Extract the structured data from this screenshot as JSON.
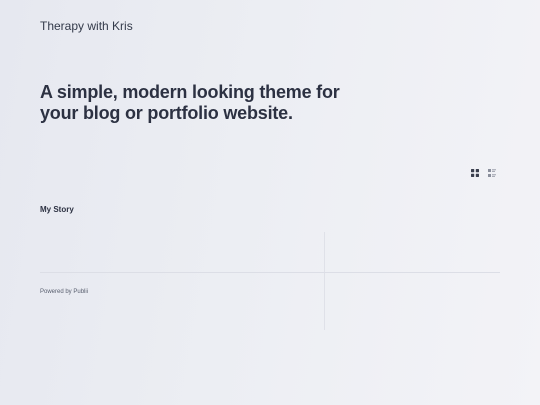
{
  "header": {
    "site_title": "Therapy with Kris"
  },
  "hero": {
    "text": "A simple, modern looking theme for your blog or portfolio website."
  },
  "view_toggle": {
    "grid_icon": "grid-view-icon",
    "list_icon": "list-view-icon",
    "active_color": "#3a3f4e",
    "inactive_color": "#8a8f9c"
  },
  "posts": [
    {
      "title": "My Story"
    }
  ],
  "footer": {
    "powered_prefix": "Powered by ",
    "powered_link": "Publii"
  }
}
